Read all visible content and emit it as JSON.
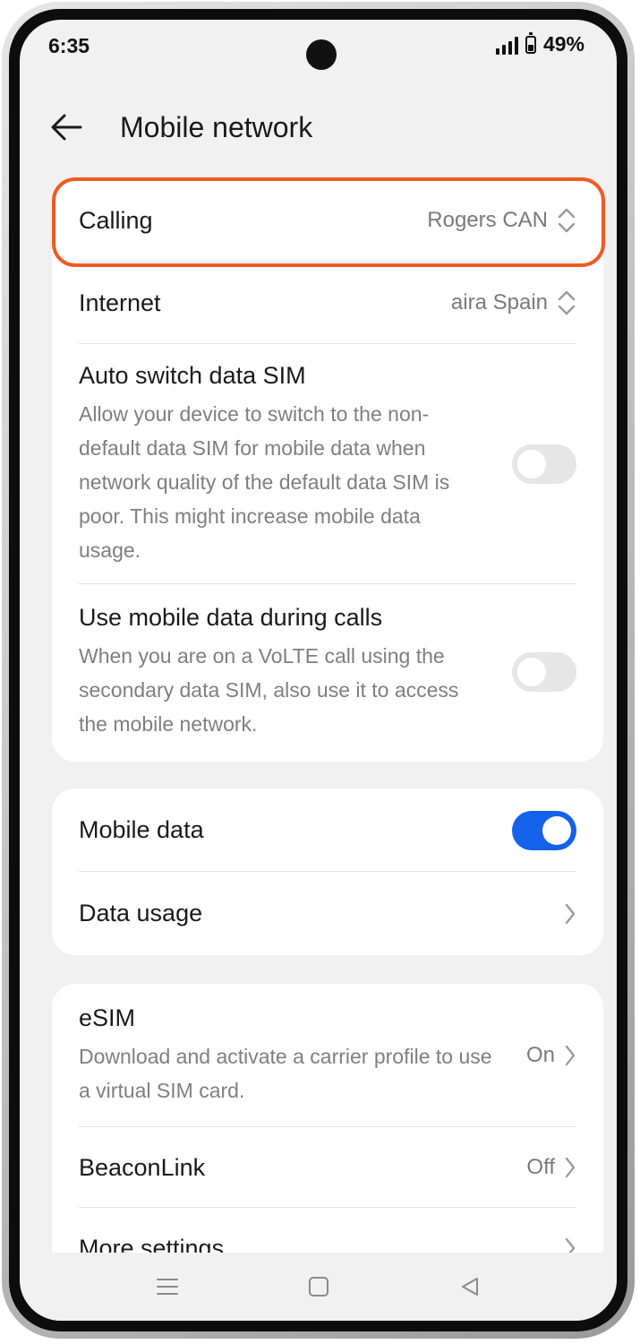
{
  "status_bar": {
    "time": "6:35",
    "battery_percent": "49%",
    "battery_level": 0.49
  },
  "header": {
    "title": "Mobile network"
  },
  "sim_section": {
    "calling": {
      "label": "Calling",
      "value": "Rogers CAN"
    },
    "internet": {
      "label": "Internet",
      "value": "aira Spain"
    },
    "auto_switch": {
      "title": "Auto switch data SIM",
      "description": "Allow your device to switch to the non-default data SIM for mobile data when network quality of the default data SIM is poor. This might increase mobile data usage.",
      "enabled": false
    },
    "data_during_calls": {
      "title": "Use mobile data during calls",
      "description": "When you are on a VoLTE call using the secondary data SIM, also use it to access the mobile network.",
      "enabled": false
    }
  },
  "data_section": {
    "mobile_data": {
      "label": "Mobile data",
      "enabled": true
    },
    "data_usage": {
      "label": "Data usage"
    }
  },
  "other_section": {
    "esim": {
      "title": "eSIM",
      "description": "Download and activate a carrier profile to use a virtual SIM card.",
      "value": "On"
    },
    "beaconlink": {
      "label": "BeaconLink",
      "value": "Off"
    },
    "more_settings": {
      "label": "More settings"
    }
  },
  "colors": {
    "accent": "#1462e8",
    "highlight": "#f15a24",
    "background": "#f1f1f1"
  }
}
